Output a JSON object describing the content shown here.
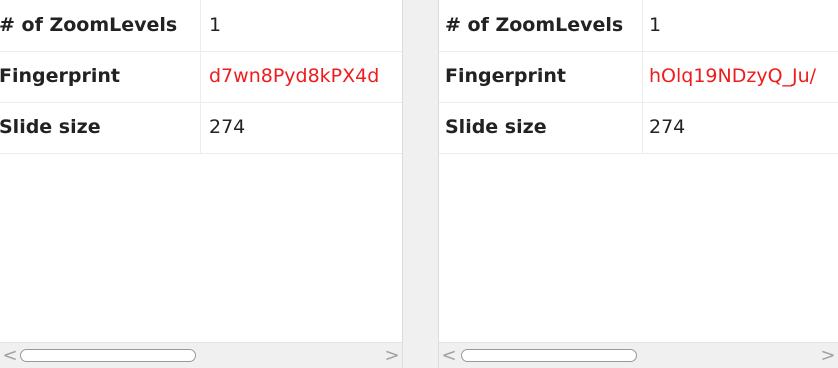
{
  "panels": [
    {
      "rows": [
        {
          "name": "# of ZoomLevels",
          "value": "1"
        },
        {
          "name": "Fingerprint",
          "value": "d7wn8Pyd8kPX4d"
        },
        {
          "name": "Slide size",
          "value": "274"
        }
      ],
      "scrollbar": {
        "left_arrow": "<",
        "right_arrow": ">"
      }
    },
    {
      "rows": [
        {
          "name": "# of ZoomLevels",
          "value": "1"
        },
        {
          "name": "Fingerprint",
          "value": "hOlq19NDzyQ_Ju/"
        },
        {
          "name": "Slide size",
          "value": "274"
        }
      ],
      "scrollbar": {
        "left_arrow": "<",
        "right_arrow": ">"
      }
    }
  ],
  "colors": {
    "fingerprint_value": "#ee1c1c",
    "text": "#222222",
    "divider_bg": "#f0f0f0"
  }
}
